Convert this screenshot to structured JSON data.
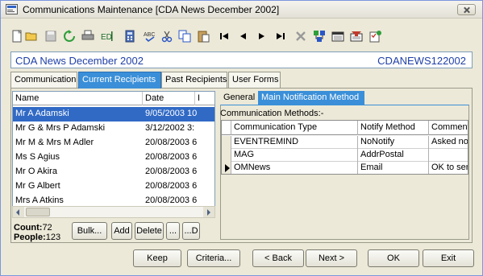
{
  "window": {
    "title": "Communications Maintenance  [CDA News December 2002]"
  },
  "toolbar": {
    "buttons": [
      {
        "icon": "new-document-icon"
      },
      {
        "icon": "open-folder-icon"
      },
      {
        "icon": "save-disk-icon"
      },
      {
        "icon": "refresh-icon"
      },
      {
        "icon": "print-icon"
      },
      {
        "icon": "edit-id-icon"
      },
      {
        "icon": "calculator-icon"
      },
      {
        "icon": "spell-check-icon"
      },
      {
        "icon": "cut-icon"
      },
      {
        "icon": "copy-icon"
      },
      {
        "icon": "paste-icon"
      },
      {
        "icon": "first-record-icon"
      },
      {
        "icon": "previous-record-icon"
      },
      {
        "icon": "next-record-icon"
      },
      {
        "icon": "last-record-icon"
      },
      {
        "icon": "delete-icon"
      },
      {
        "icon": "network-icon"
      },
      {
        "icon": "calendar-icon"
      },
      {
        "icon": "filter-icon"
      },
      {
        "icon": "checklist-icon"
      }
    ]
  },
  "header": {
    "left": "CDA News December 2002",
    "right": "CDANEWS122002"
  },
  "tabs": [
    {
      "label": "Communication",
      "active": false
    },
    {
      "label": "Current Recipients",
      "active": true
    },
    {
      "label": "Past Recipients",
      "active": false
    },
    {
      "label": "User Forms",
      "active": false
    }
  ],
  "recipients": {
    "columns": [
      "Name",
      "Date",
      "I"
    ],
    "rows": [
      {
        "name": "Mr A Adamski",
        "date": "9/05/2003 10",
        "selected": true
      },
      {
        "name": "Mr G & Mrs P Adamski",
        "date": "3/12/2002 3:",
        "selected": false
      },
      {
        "name": "Mr M & Mrs M Adler",
        "date": "20/08/2003 6",
        "selected": false
      },
      {
        "name": "Ms S Agius",
        "date": "20/08/2003 6",
        "selected": false
      },
      {
        "name": "Mr O Akira",
        "date": "20/08/2003 6",
        "selected": false
      },
      {
        "name": "Mr G Albert",
        "date": "20/08/2003 6",
        "selected": false
      },
      {
        "name": "Mrs A Atkins",
        "date": "20/08/2003 6",
        "selected": false
      }
    ]
  },
  "counts": {
    "count_label": "Count:",
    "count_value": "72",
    "people_label": "People:",
    "people_value": "123"
  },
  "list_buttons": [
    "Bulk...",
    "Add",
    "Delete",
    "...",
    "...D"
  ],
  "subtabs": [
    {
      "label": "General",
      "active": false
    },
    {
      "label": "Main Notification Method",
      "active": true
    }
  ],
  "comm_methods": {
    "label": "Communication Methods:-",
    "columns": [
      "Communication Type",
      "Notify Method",
      "Comment"
    ],
    "rows": [
      {
        "type": "EVENTREMIND",
        "notify": "NoNotify",
        "comment": "Asked not",
        "current": false
      },
      {
        "type": "MAG",
        "notify": "AddrPostal",
        "comment": "",
        "current": false
      },
      {
        "type": "OMNews",
        "notify": "Email",
        "comment": "OK to sen",
        "current": true
      }
    ]
  },
  "footer": {
    "keep": "Keep",
    "criteria": "Criteria...",
    "back": "< Back",
    "next": "Next >",
    "ok": "OK",
    "exit": "Exit"
  }
}
